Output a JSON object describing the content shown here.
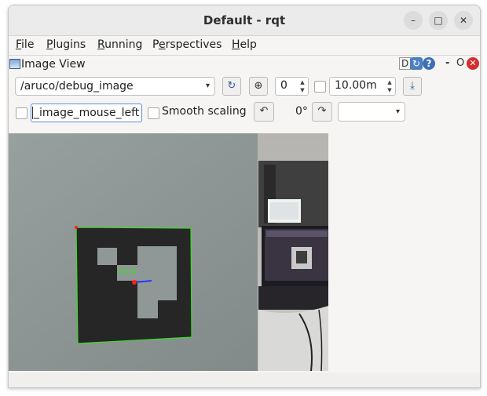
{
  "window": {
    "title": "Default - rqt",
    "minimize_glyph": "–",
    "maximize_glyph": "□",
    "close_glyph": "✕"
  },
  "menu": [
    {
      "mnemonic": "F",
      "rest": "ile"
    },
    {
      "mnemonic": "P",
      "rest": "lugins"
    },
    {
      "mnemonic": "R",
      "rest": "unning"
    },
    {
      "pre": "P",
      "mnemonic": "e",
      "rest": "rspectives"
    },
    {
      "mnemonic": "H",
      "rest": "elp"
    }
  ],
  "dock": {
    "title": "Image View",
    "d_label": "D",
    "refresh_glyph": "↻",
    "help_glyph": "?",
    "minus_label": "-",
    "float_label": "O",
    "close_glyph": "✕"
  },
  "toolbar": {
    "topic": "/aruco/debug_image",
    "dropdown_glyph": "▾",
    "refresh_glyph": "↻",
    "zoom_glyph": "⊕",
    "zoom_value": "0",
    "spin_up": "▲",
    "spin_down": "▼",
    "max_range": "10.00m",
    "save_glyph": "⤓"
  },
  "row2": {
    "mouse_topic": "_image_mouse_left",
    "smooth_label": "Smooth scaling",
    "rotate_left_glyph": "↶",
    "rotation": "0°",
    "rotate_right_glyph": "↷",
    "combo_value": "",
    "dropdown_glyph": "▾"
  },
  "image": {
    "marker_label": "ID:0"
  },
  "colors": {
    "accent": "#4b7fc2",
    "close_red": "#d32f2f",
    "marker_outline": "#3cdc28",
    "marker_axis_x": "#1e3cff",
    "marker_axis_y": "#ff1e1e"
  }
}
